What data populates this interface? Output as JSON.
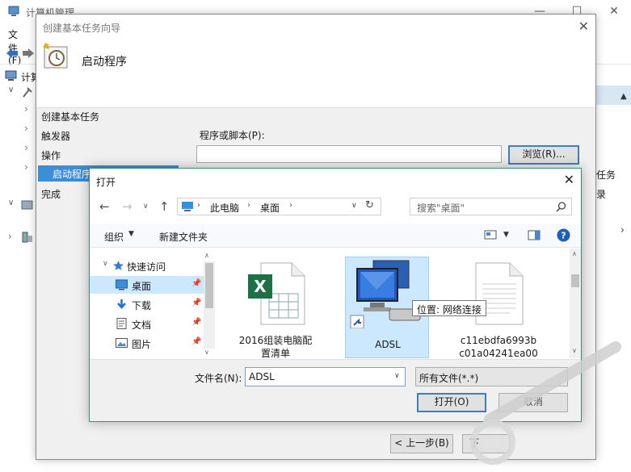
{
  "computer_management": {
    "title": "计算机管理",
    "menu_file": "文件(F)",
    "tree_item": "计算",
    "right_item_1": "任务",
    "right_item_2": "录"
  },
  "wizard": {
    "title": "创建基本任务向导",
    "header_title": "启动程序",
    "steps": [
      "创建基本任务",
      "触发器",
      "操作",
      "启动程序",
      "完成"
    ],
    "program_label": "程序或脚本(P):",
    "program_value": "",
    "browse_button": "浏览(R)...",
    "back_button": "< 上一步(B)",
    "next_button": "下"
  },
  "open_dialog": {
    "title": "打开",
    "breadcrumb": [
      "此电脑",
      "桌面"
    ],
    "search_placeholder": "搜索\"桌面\"",
    "organize_label": "组织",
    "new_folder_label": "新建文件夹",
    "nav_items": [
      {
        "label": "快速访问",
        "icon": "star-icon"
      },
      {
        "label": "桌面",
        "icon": "desktop-icon"
      },
      {
        "label": "下载",
        "icon": "download-icon"
      },
      {
        "label": "文档",
        "icon": "document-icon"
      },
      {
        "label": "图片",
        "icon": "picture-icon"
      }
    ],
    "files": [
      {
        "name_line1": "2016组装电脑配",
        "name_line2": "置清单",
        "type": "excel-file-icon"
      },
      {
        "name_line1": "ADSL",
        "name_line2": "",
        "type": "network-connection-icon"
      },
      {
        "name_line1": "c11ebdfa6993b",
        "name_line2": "c01a04241ea00",
        "type": "text-file-icon"
      }
    ],
    "tooltip": "位置: 网络连接",
    "file_name_label": "文件名(N):",
    "file_name_value": "ADSL",
    "file_type_value": "所有文件(*.*)",
    "open_button": "打开(O)",
    "cancel_button": "取消"
  },
  "colors": {
    "selection_blue": "#3c8ed8",
    "file_selected": "#cce8ff",
    "dialog_border": "#3c8c6e"
  }
}
